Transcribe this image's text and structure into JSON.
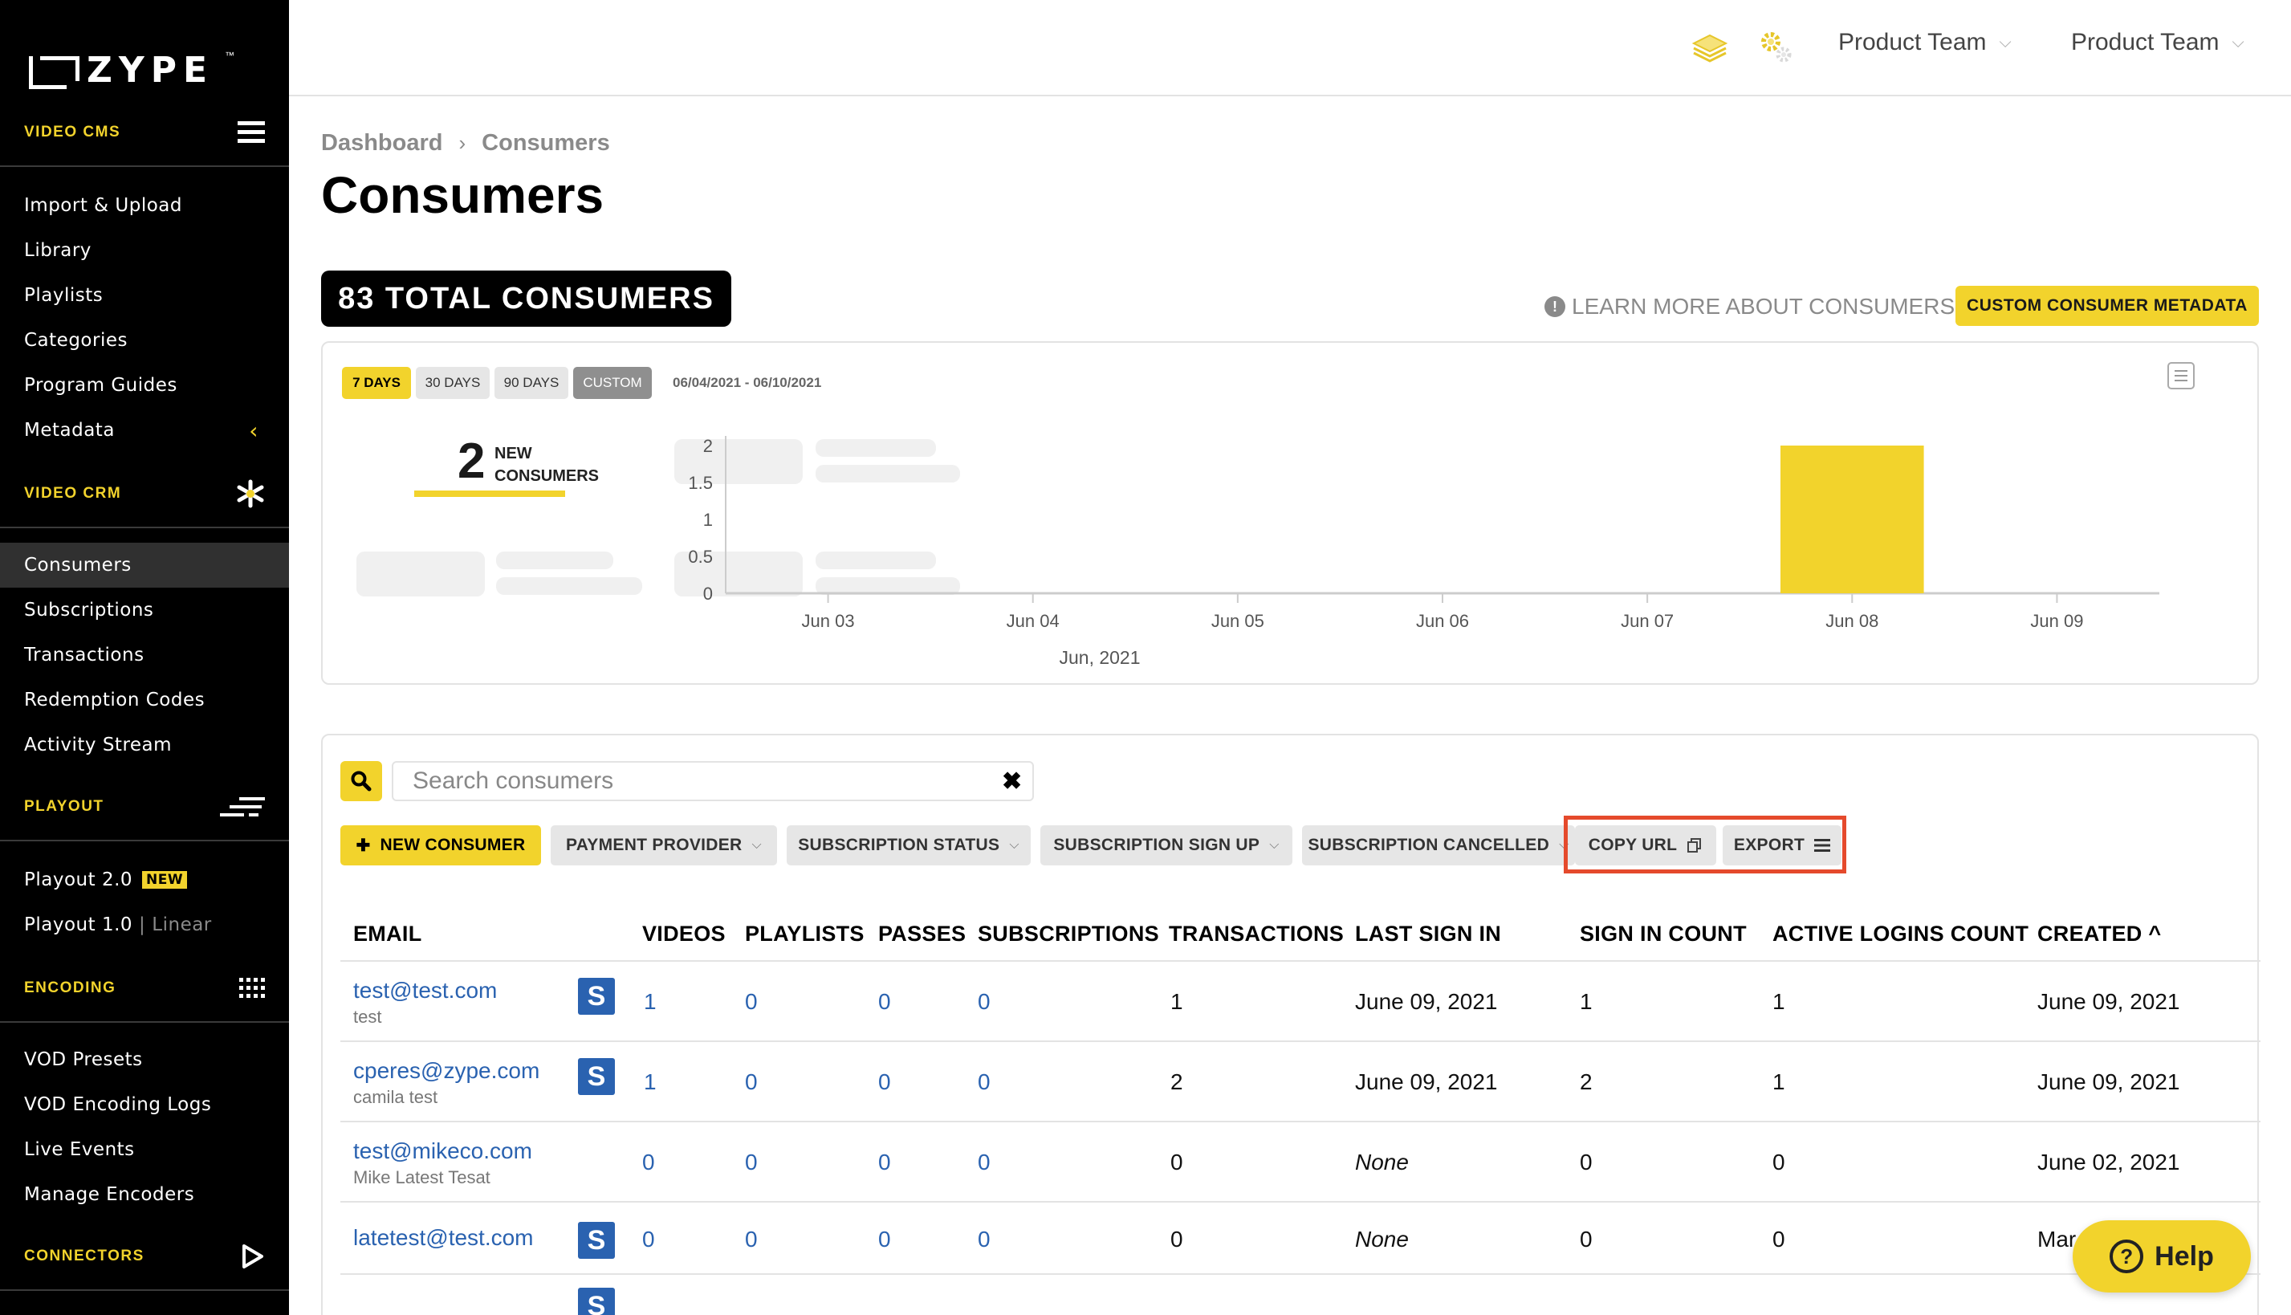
{
  "brand": {
    "logo_text": "ZYPE",
    "trademark": "™"
  },
  "colors": {
    "accent": "#f2d32c",
    "sidebar_bg": "#000000",
    "link": "#2a62b0",
    "highlight": "#e54a2c"
  },
  "sidebar": {
    "sections": [
      {
        "label": "VIDEO CMS",
        "icon": "hamburger-icon",
        "items": [
          {
            "label": "Import & Upload"
          },
          {
            "label": "Library"
          },
          {
            "label": "Playlists"
          },
          {
            "label": "Categories"
          },
          {
            "label": "Program Guides"
          },
          {
            "label": "Metadata",
            "icon": "chevron-left-icon"
          }
        ]
      },
      {
        "label": "VIDEO CRM",
        "icon": "asterisk-icon",
        "items": [
          {
            "label": "Consumers",
            "active": true
          },
          {
            "label": "Subscriptions"
          },
          {
            "label": "Transactions"
          },
          {
            "label": "Redemption Codes"
          },
          {
            "label": "Activity Stream"
          }
        ]
      },
      {
        "label": "PLAYOUT",
        "icon": "playout-lines-icon",
        "items": [
          {
            "label": "Playout 2.0",
            "badge": "NEW"
          },
          {
            "label": "Playout 1.0",
            "separator": "|",
            "suffix": "Linear"
          }
        ]
      },
      {
        "label": "ENCODING",
        "icon": "grid-dots-icon",
        "items": [
          {
            "label": "VOD Presets"
          },
          {
            "label": "VOD Encoding Logs"
          },
          {
            "label": "Live Events"
          },
          {
            "label": "Manage Encoders"
          }
        ]
      },
      {
        "label": "CONNECTORS",
        "icon": "play-outline-icon",
        "items": []
      }
    ]
  },
  "topbar": {
    "team1": "Product Team",
    "team2": "Product Team"
  },
  "breadcrumb": {
    "root": "Dashboard",
    "separator": "›",
    "current": "Consumers"
  },
  "page_title": "Consumers",
  "total_banner": "83 TOTAL CONSUMERS",
  "learn_more": "LEARN MORE ABOUT CONSUMERS",
  "metadata_button": "CUSTOM CONSUMER METADATA",
  "chart": {
    "ranges": [
      {
        "label": "7 DAYS"
      },
      {
        "label": "30 DAYS"
      },
      {
        "label": "90 DAYS"
      },
      {
        "label": "CUSTOM"
      }
    ],
    "date_range": "06/04/2021 - 06/10/2021",
    "stat_value": "2",
    "stat_label_1": "NEW",
    "stat_label_2": "CONSUMERS",
    "month_label": "Jun, 2021"
  },
  "chart_data": {
    "type": "bar",
    "categories": [
      "Jun 03",
      "Jun 04",
      "Jun 05",
      "Jun 06",
      "Jun 07",
      "Jun 08",
      "Jun 09"
    ],
    "values": [
      0,
      0,
      0,
      0,
      0,
      2,
      0
    ],
    "yticks": [
      "0",
      "0.5",
      "1",
      "1.5",
      "2"
    ],
    "ylim": [
      0,
      2
    ],
    "xlabel": "Jun, 2021",
    "bar_color": "#f2d32c"
  },
  "table_tools": {
    "search_placeholder": "Search consumers",
    "new_consumer": "NEW CONSUMER",
    "filters": [
      "PAYMENT PROVIDER",
      "SUBSCRIPTION STATUS",
      "SUBSCRIPTION SIGN UP",
      "SUBSCRIPTION CANCELLED"
    ],
    "copy_url": "COPY URL",
    "export": "EXPORT"
  },
  "table": {
    "headers": [
      "EMAIL",
      "VIDEOS",
      "PLAYLISTS",
      "PASSES",
      "SUBSCRIPTIONS",
      "TRANSACTIONS",
      "LAST SIGN IN",
      "SIGN IN COUNT",
      "ACTIVE LOGINS COUNT",
      "CREATED"
    ],
    "sort_indicator": "^",
    "rows": [
      {
        "email": "test@test.com",
        "name": "test",
        "badge": "S",
        "videos": "1",
        "playlists": "0",
        "passes": "0",
        "subscriptions": "0",
        "transactions": "1",
        "last_sign_in": "June 09, 2021",
        "sign_in_count": "1",
        "active_logins": "1",
        "created": "June 09, 2021"
      },
      {
        "email": "cperes@zype.com",
        "name": "camila test",
        "badge": "S",
        "videos": "1",
        "playlists": "0",
        "passes": "0",
        "subscriptions": "0",
        "transactions": "2",
        "last_sign_in": "June 09, 2021",
        "sign_in_count": "2",
        "active_logins": "1",
        "created": "June 09, 2021"
      },
      {
        "email": "test@mikeco.com",
        "name": "Mike Latest Tesat",
        "badge": "",
        "videos": "0",
        "playlists": "0",
        "passes": "0",
        "subscriptions": "0",
        "transactions": "0",
        "last_sign_in": "None",
        "sign_in_count": "0",
        "active_logins": "0",
        "created": "June 02, 2021"
      },
      {
        "email": "latetest@test.com",
        "name": "",
        "badge": "S",
        "videos": "0",
        "playlists": "0",
        "passes": "0",
        "subscriptions": "0",
        "transactions": "0",
        "last_sign_in": "None",
        "sign_in_count": "0",
        "active_logins": "0",
        "created": "Mar"
      },
      {
        "email": "",
        "name": "",
        "badge": "S"
      }
    ]
  },
  "help_button": "Help"
}
